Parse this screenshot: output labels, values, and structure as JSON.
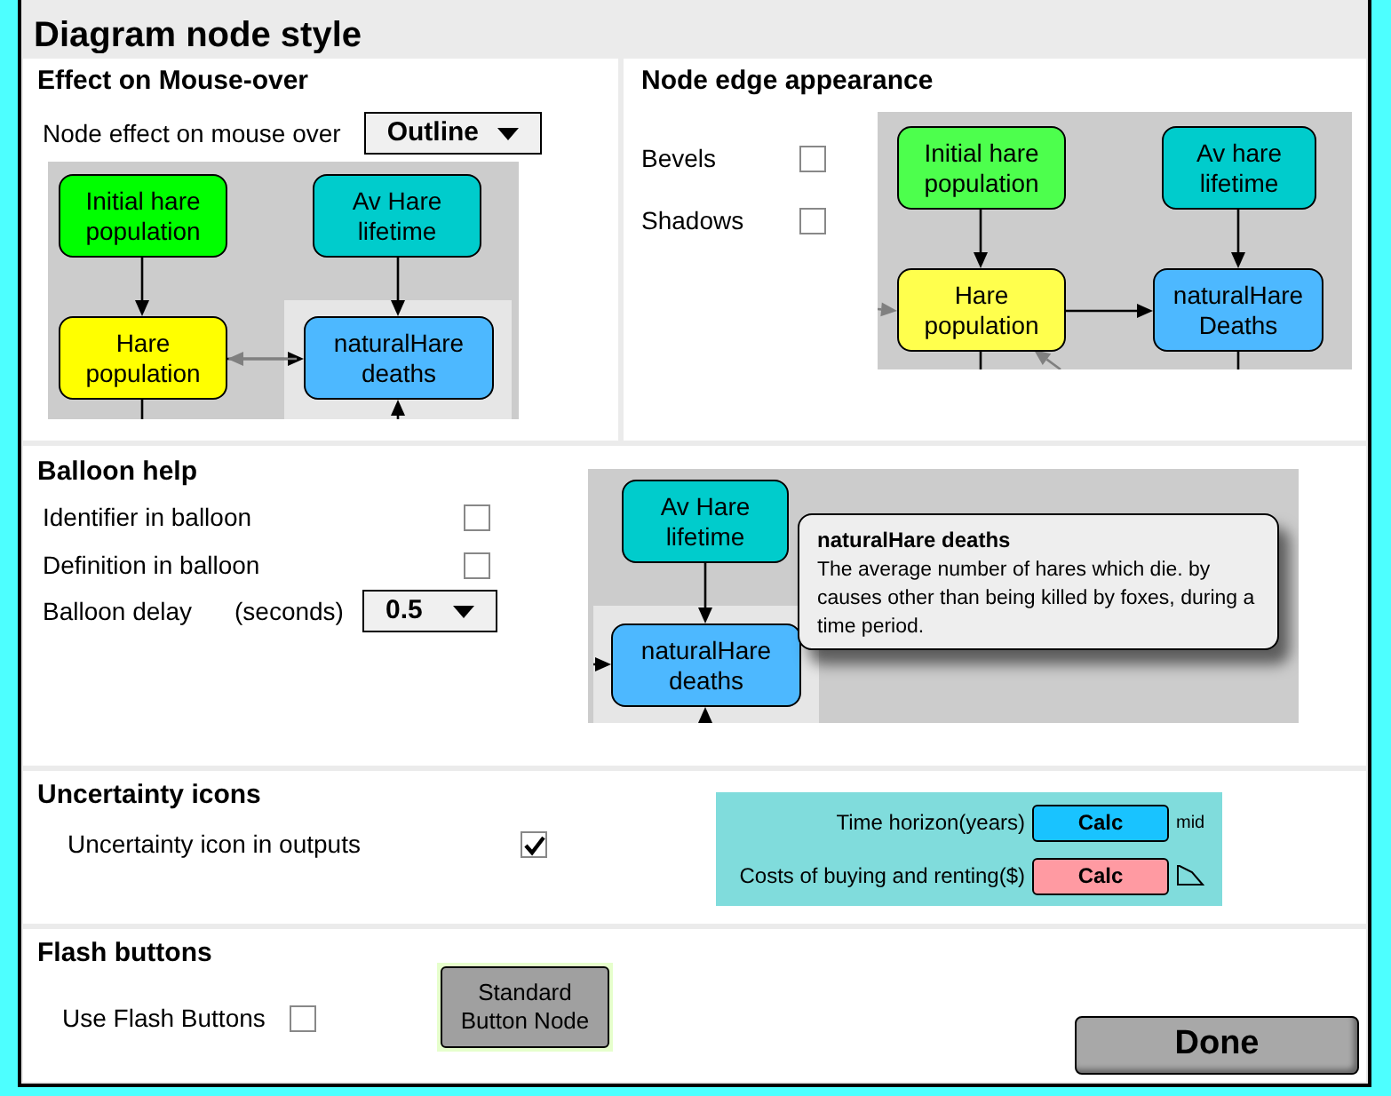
{
  "window": {
    "title": "Diagram node style"
  },
  "mouseover": {
    "title": "Effect on Mouse-over",
    "label": "Node effect on mouse over",
    "dropdown": "Outline",
    "nodes": [
      {
        "label": "Initial hare population",
        "color": "#00ff00"
      },
      {
        "label": "Av Hare lifetime",
        "color": "#00cccc"
      },
      {
        "label": "Hare population",
        "color": "#ffff00"
      },
      {
        "label": "naturalHare deaths",
        "color": "#4db8ff"
      }
    ]
  },
  "edge": {
    "title": "Node edge appearance",
    "options": [
      {
        "label": "Bevels",
        "checked": false
      },
      {
        "label": "Shadows",
        "checked": false
      }
    ],
    "nodes": [
      {
        "label": "Initial hare population",
        "color": "#4dff4d"
      },
      {
        "label": "Av hare lifetime",
        "color": "#00cccc"
      },
      {
        "label": "Hare population",
        "color": "#ffff4d"
      },
      {
        "label": "naturalHare Deaths",
        "color": "#4db8ff"
      }
    ]
  },
  "balloon": {
    "title": "Balloon help",
    "options": [
      {
        "label": "Identifier in balloon",
        "checked": false
      },
      {
        "label": "Definition in balloon",
        "checked": false
      }
    ],
    "delay_label": "Balloon delay",
    "delay_unit": "(seconds)",
    "delay": "0.5",
    "nodes": [
      {
        "label": "Av Hare lifetime",
        "color": "#00cccc"
      },
      {
        "label": "naturalHare deaths",
        "color": "#4db8ff"
      }
    ],
    "tooltip": {
      "title": "naturalHare deaths",
      "text": "The average number of hares which die. by causes other than being killed by foxes, during a time period."
    }
  },
  "uncertainty": {
    "title": "Uncertainty icons",
    "label": "Uncertainty icon in outputs",
    "checked": true,
    "rows": [
      {
        "label": "Time horizon(years)",
        "button": "Calc",
        "color": "#19c3ff",
        "kind": "text",
        "marker": "mid"
      },
      {
        "label": "Costs of buying and renting($)",
        "button": "Calc",
        "color": "#ff9aa2",
        "kind": "icon"
      }
    ]
  },
  "flash": {
    "title": "Flash buttons",
    "label": "Use Flash Buttons",
    "checked": false,
    "button": "Standard Button Node"
  },
  "done": "Done"
}
